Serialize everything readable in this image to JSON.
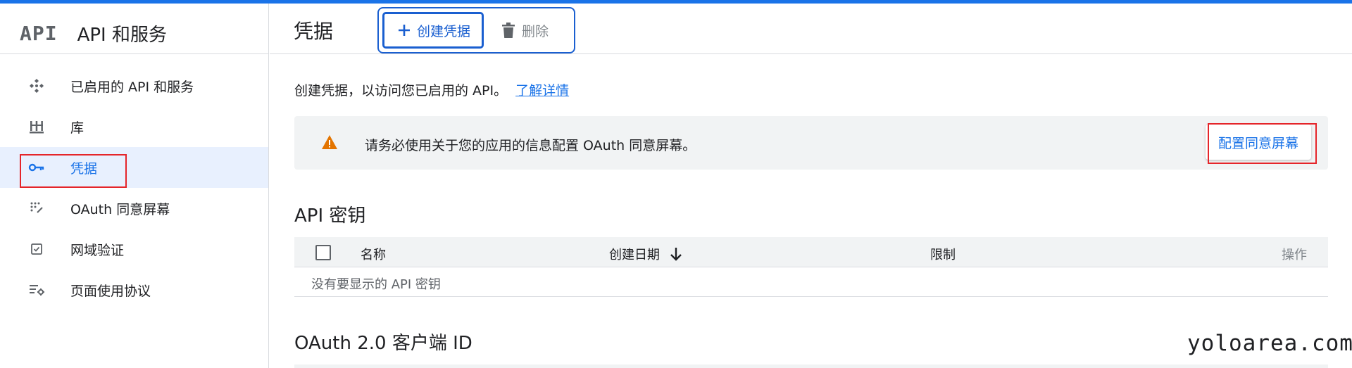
{
  "brand": {
    "logo": "API",
    "title": "API 和服务"
  },
  "sidebar": {
    "items": [
      {
        "label": "已启用的 API 和服务",
        "icon": "api-diamond-icon"
      },
      {
        "label": "库",
        "icon": "library-icon"
      },
      {
        "label": "凭据",
        "icon": "key-icon",
        "active": true
      },
      {
        "label": "OAuth 同意屏幕",
        "icon": "consent-dots-icon"
      },
      {
        "label": "网域验证",
        "icon": "checkbox-icon"
      },
      {
        "label": "页面使用协议",
        "icon": "settings-list-icon"
      }
    ]
  },
  "header": {
    "title": "凭据",
    "create_label": "创建凭据",
    "delete_label": "删除"
  },
  "main": {
    "intro_text": "创建凭据，以访问您已启用的 API。",
    "learn_more": "了解详情",
    "banner": {
      "text": "请务必使用关于您的应用的信息配置 OAuth 同意屏幕。",
      "button": "配置同意屏幕"
    },
    "api_keys": {
      "title": "API 密钥",
      "columns": {
        "name": "名称",
        "created": "创建日期",
        "restrictions": "限制",
        "actions": "操作"
      },
      "empty": "没有要显示的 API 密钥"
    },
    "oauth_title": "OAuth 2.0 客户端 ID"
  },
  "watermark": "yoloarea.com",
  "colors": {
    "accent": "#1a73e8",
    "highlight": "#e5252a",
    "warning": "#e37400"
  }
}
